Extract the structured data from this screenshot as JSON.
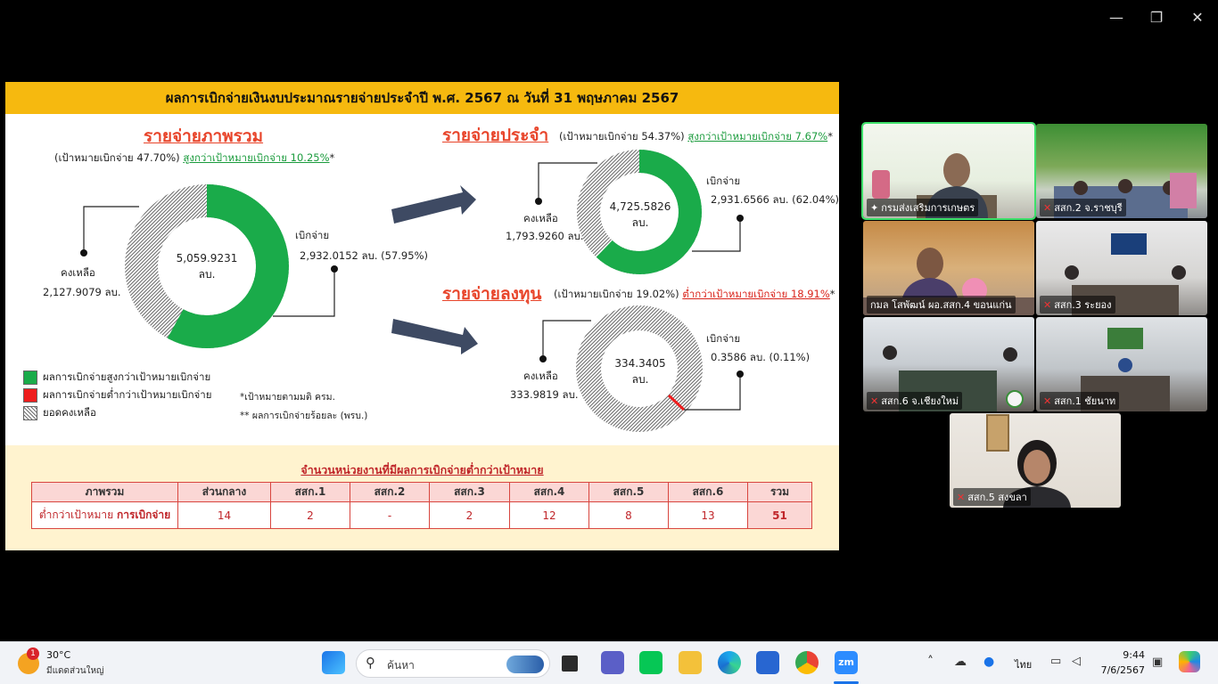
{
  "window": {
    "minimize": "—",
    "restore": "❐",
    "close": "✕"
  },
  "slide": {
    "header": "ผลการเบิกจ่ายเงินงบประมาณรายจ่ายประจำปี พ.ศ. 2567 ณ วันที่ 31 พฤษภาคม 2567",
    "overall": {
      "title": "รายจ่ายภาพรวม",
      "target_note": "(เป้าหมายเบิกจ่าย 47.70%)",
      "vs_target": "สูงกว่าเป้าหมายเบิกจ่าย 10.25%",
      "star": "*",
      "total": "5,059.9231",
      "unit": "ลบ.",
      "disbursed_label": "เบิกจ่าย",
      "disbursed_value": "2,932.0152 ลบ. (57.95%)",
      "remaining_label": "คงเหลือ",
      "remaining_value": "2,127.9079 ลบ.",
      "disbursed_fraction": 0.5795
    },
    "recurring": {
      "title": "รายจ่ายประจำ",
      "target_note": "(เป้าหมายเบิกจ่าย 54.37%)",
      "vs_target": "สูงกว่าเป้าหมายเบิกจ่าย 7.67%",
      "star": "*",
      "total": "4,725.5826",
      "unit": "ลบ.",
      "disbursed_label": "เบิกจ่าย",
      "disbursed_value": "2,931.6566 ลบ. (62.04%)",
      "remaining_label": "คงเหลือ",
      "remaining_value": "1,793.9260 ลบ.",
      "disbursed_fraction": 0.6204
    },
    "investment": {
      "title": "รายจ่ายลงทุน",
      "target_note": "(เป้าหมายเบิกจ่าย 19.02%)",
      "vs_target": "ต่ำกว่าเป้าหมายเบิกจ่าย 18.91%",
      "star": "*",
      "total": "334.3405",
      "unit": "ลบ.",
      "disbursed_label": "เบิกจ่าย",
      "disbursed_value": "0.3586 ลบ. (0.11%)",
      "remaining_label": "คงเหลือ",
      "remaining_value": "333.9819 ลบ.",
      "disbursed_fraction": 0.0011
    },
    "legend": [
      {
        "label": "ผลการเบิกจ่ายสูงกว่าเป้าหมายเบิกจ่าย",
        "color": "#1aab4a"
      },
      {
        "label": "ผลการเบิกจ่ายต่ำกว่าเป้าหมายเบิกจ่าย",
        "color": "#ee1c1c"
      },
      {
        "label": "ยอดคงเหลือ",
        "color": "hatch"
      }
    ],
    "notes": [
      "*เป้าหมายตามมติ ครม.",
      "** ผลการเบิกจ่ายร้อยละ (พรบ.)"
    ],
    "table": {
      "title": "จำนวนหน่วยงานที่มีผลการเบิกจ่ายต่ำกว่าเป้าหมาย",
      "headers": [
        "ภาพรวม",
        "ส่วนกลาง",
        "สสก.1",
        "สสก.2",
        "สสก.3",
        "สสก.4",
        "สสก.5",
        "สสก.6",
        "รวม"
      ],
      "row_label_plain": "ต่ำกว่าเป้าหมาย ",
      "row_label_bold": "การเบิกจ่าย",
      "values": [
        "14",
        "2",
        "-",
        "2",
        "12",
        "8",
        "13",
        "51"
      ]
    }
  },
  "participants": [
    {
      "name": "กรมส่งเสริมการเกษตร",
      "muted": false,
      "active": true
    },
    {
      "name": "สสก.2 จ.ราชบุรี",
      "muted": true,
      "active": false
    },
    {
      "name": "กมล โสพัฒน์ ผอ.สสก.4 ขอนแก่น",
      "muted": false,
      "active": false
    },
    {
      "name": "สสก.3 ระยอง",
      "muted": true,
      "active": false
    },
    {
      "name": "สสก.6 จ.เชียงใหม่",
      "muted": true,
      "active": false
    },
    {
      "name": "สสก.1 ชัยนาท",
      "muted": true,
      "active": false
    },
    {
      "name": "สสก.5 สงขลา",
      "muted": true,
      "active": false
    }
  ],
  "taskbar": {
    "weather_temp": "30°C",
    "weather_desc": "มีแดดส่วนใหญ่",
    "weather_badge": "1",
    "search_placeholder": "ค้นหา",
    "language": "ไทย",
    "time": "9:44",
    "date": "7/6/2567"
  }
}
